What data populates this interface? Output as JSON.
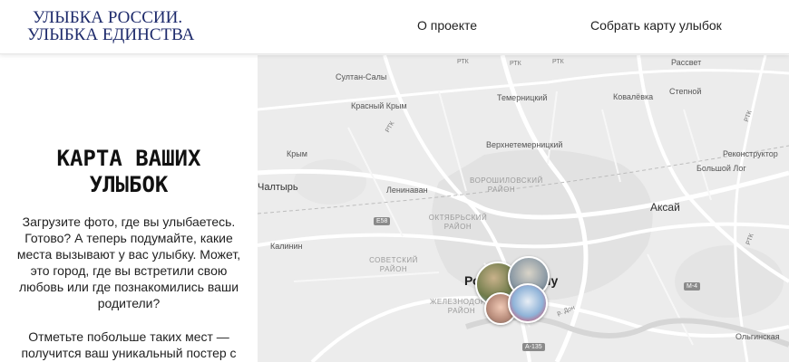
{
  "header": {
    "logo_line1": "УЛЫБКА РОССИИ.",
    "logo_line2": "УЛЫБКА ЕДИНСТВА",
    "nav_about": "О проекте",
    "nav_collect": "Собрать карту улыбок"
  },
  "intro": {
    "title": "КАРТА ВАШИХ УЛЫБОК",
    "paragraph1": "Загрузите фото, где вы улыбаетесь. Готово? А теперь подумайте, какие места вызывают у вас улыбку. Может, это город, где вы встретили свою любовь или где познакомились ваши родители?",
    "paragraph2": "Отметьте побольше таких мест — получится ваш уникальный постер с"
  },
  "map": {
    "places": {
      "sultan_saly": "Султан-Салы",
      "krasny_krym": "Красный Крым",
      "krym": "Крым",
      "chaltyr": "Чалтырь",
      "leninavan": "Ленинаван",
      "kalinin": "Калинин",
      "temernitsky": "Темерницкий",
      "verkhnetemernitsky": "Верхнетемерницкий",
      "kovalevka": "Ковалёвка",
      "rassvet": "Рассвет",
      "stepnoy": "Степной",
      "rekonstruktor": "Реконструктор",
      "bolshoy_log": "Большой Лог",
      "aksay": "Аксай",
      "olginskaya": "Ольгинская",
      "city_left": "Ро",
      "city_right": "ну"
    },
    "districts": {
      "voroshilovsky": "ВОРОШИЛОВСКИЙ РАЙОН",
      "oktyabrsky": "ОКТЯБРЬСКИЙ РАЙОН",
      "sovetsky": "СОВЕТСКИЙ РАЙОН",
      "zheleznodorozhny": "ЖЕЛЕЗНОДОРОЖНЫЙ РАЙОН"
    },
    "roads": {
      "rtk": "РТК",
      "e58": "E58",
      "m4": "М-4",
      "a135": "А-135",
      "don": "р. Дон"
    }
  }
}
